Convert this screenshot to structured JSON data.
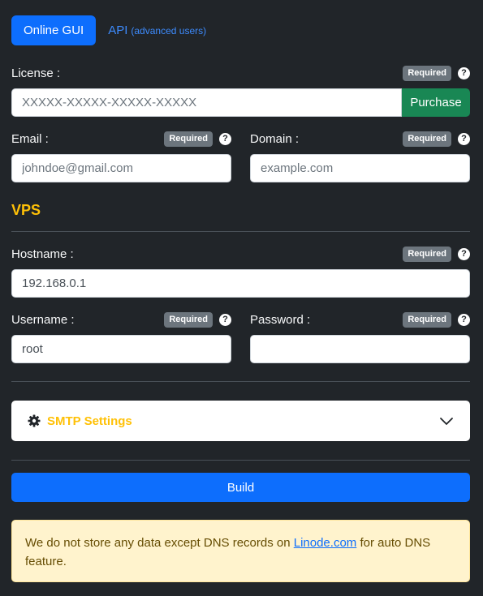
{
  "tabs": {
    "online": "Online GUI",
    "api": "API",
    "api_note": "(advanced users)"
  },
  "required_badge": "Required",
  "help_glyph": "?",
  "license": {
    "label": "License :",
    "placeholder": "XXXXX-XXXXX-XXXXX-XXXXX",
    "purchase": "Purchase"
  },
  "email": {
    "label": "Email :",
    "placeholder": "johndoe@gmail.com"
  },
  "domain": {
    "label": "Domain :",
    "placeholder": "example.com"
  },
  "vps": {
    "title": "VPS",
    "hostname": {
      "label": "Hostname :",
      "value": "192.168.0.1"
    },
    "username": {
      "label": "Username :",
      "value": "root"
    },
    "password": {
      "label": "Password :",
      "value": ""
    }
  },
  "smtp": {
    "title": "SMTP Settings",
    "icon": "gear-icon",
    "chevron": "chevron-down-icon"
  },
  "build": "Build",
  "alert": {
    "before": "We do not store any data except DNS records on ",
    "link": "Linode.com",
    "after": " for auto DNS feature."
  },
  "colors": {
    "background": "#212529",
    "primary": "#0d6efd",
    "success": "#198754",
    "warning": "#ffc107",
    "badge": "#6c757d",
    "alert_bg": "#fff3cd"
  }
}
